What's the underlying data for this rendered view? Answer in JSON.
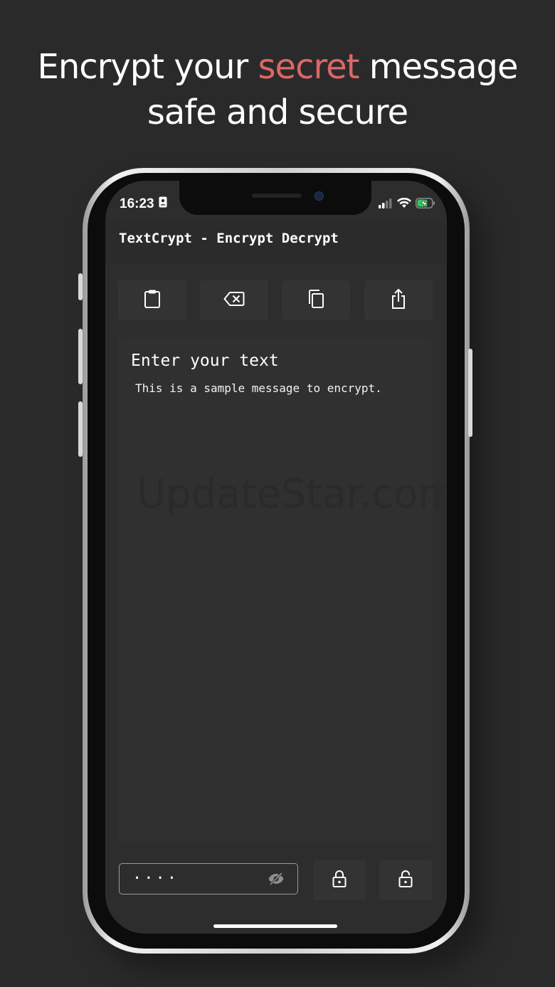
{
  "headline": {
    "line1_before": "Encrypt your ",
    "line1_accent": "secret",
    "line1_after": " message",
    "line2": "safe and secure",
    "accent_color": "#e06666"
  },
  "status_bar": {
    "time": "16:23",
    "icons": [
      "contact-card-icon",
      "signal-icon",
      "wifi-icon",
      "battery-charging-icon"
    ]
  },
  "app_bar": {
    "title": "TextCrypt - Encrypt Decrypt"
  },
  "toolbar": {
    "buttons": [
      {
        "name": "paste-button",
        "icon": "clipboard-icon"
      },
      {
        "name": "clear-button",
        "icon": "backspace-icon"
      },
      {
        "name": "copy-button",
        "icon": "copy-icon"
      },
      {
        "name": "share-button",
        "icon": "share-icon"
      }
    ]
  },
  "editor": {
    "label": "Enter your text",
    "value": "This is a sample message to encrypt."
  },
  "watermark": "UpdateStar.com",
  "password": {
    "value": "····",
    "visibility_icon": "eye-off-icon"
  },
  "actions": [
    {
      "name": "encrypt-button",
      "icon": "lock-icon"
    },
    {
      "name": "decrypt-button",
      "icon": "unlock-icon"
    }
  ]
}
